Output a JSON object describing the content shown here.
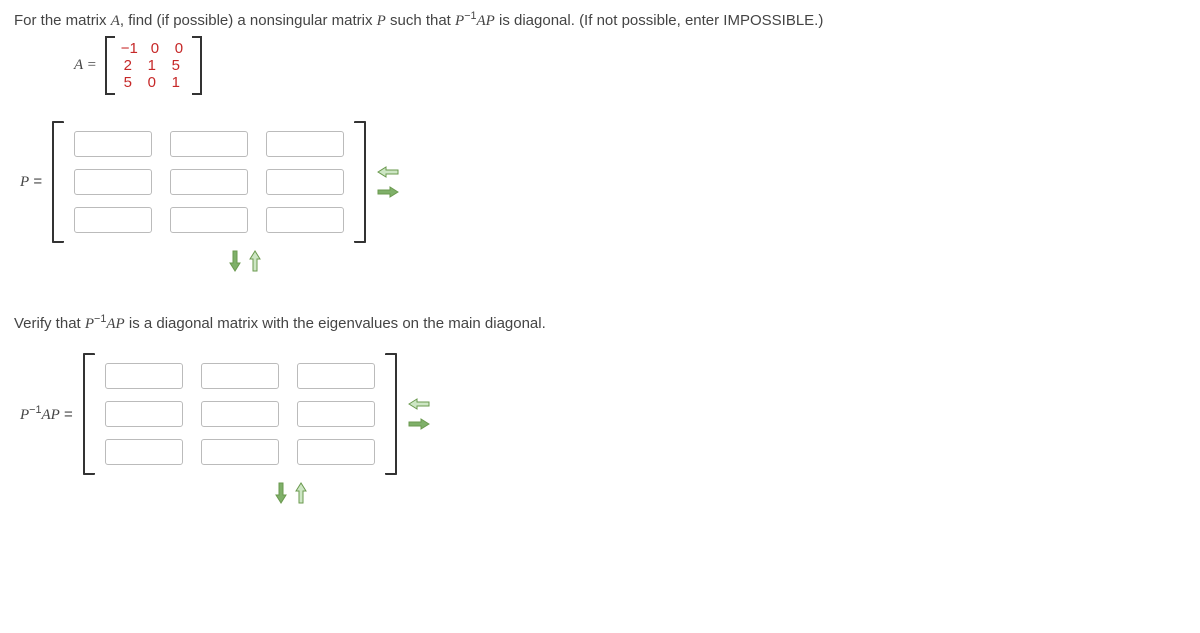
{
  "problem": {
    "text_before": "For the matrix ",
    "A": "A",
    "text_mid": ", find (if possible) a nonsingular matrix ",
    "P": "P",
    "text_such": " such that ",
    "expr_pre": "P",
    "expr_exp": "−1",
    "AP": "AP",
    "text_diag": " is diagonal. (If not possible, enter IMPOSSIBLE.)"
  },
  "matrix_def": {
    "label": "A =",
    "rows": [
      [
        "−1",
        "0",
        "0"
      ],
      [
        "2",
        "1",
        "5"
      ],
      [
        "5",
        "0",
        "1"
      ]
    ]
  },
  "P_label": {
    "P": "P",
    "eq": " ="
  },
  "verify": {
    "pre": "Verify that ",
    "P": "P",
    "exp": "−1",
    "AP": "AP",
    "post": " is a diagonal matrix with the eigenvalues on the main diagonal."
  },
  "PAP_label": {
    "P": "P",
    "exp": "−1",
    "AP": "AP",
    "eq": " ="
  },
  "colors": {
    "matrix_value": "#c62828",
    "arrow_fill_light": "#cde6c4",
    "arrow_fill_dark": "#7fb069",
    "arrow_stroke": "#6a994e"
  }
}
